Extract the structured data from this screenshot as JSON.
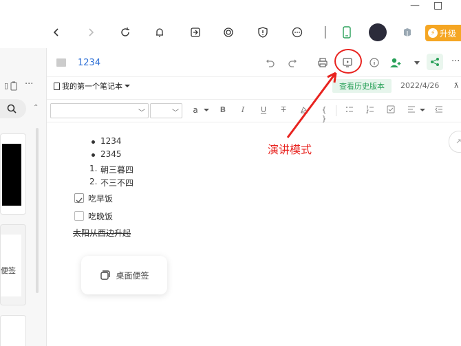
{
  "window": {
    "minimize": "—",
    "maximize": "□"
  },
  "toolbar": {
    "upgrade_label": "升级"
  },
  "note": {
    "title": "1234",
    "notebook": "我的第一个笔记本",
    "history_label": "查看历史版本",
    "date": "2022/4/26"
  },
  "format": {
    "font_color_label": "a"
  },
  "content": {
    "bullets": [
      "1234",
      "2345"
    ],
    "numbered": [
      {
        "num": "1.",
        "text": "朝三暮四"
      },
      {
        "num": "2.",
        "text": "不三不四"
      }
    ],
    "tasks": [
      {
        "text": "吃早饭",
        "checked": true
      },
      {
        "text": "吃晚饭",
        "checked": false
      }
    ],
    "struck": "太阳从西边升起",
    "sticky_label": "桌面便签"
  },
  "sidebar": {
    "card_text": "便签"
  },
  "annotation": {
    "label": "演讲模式",
    "color": "#e8231f"
  },
  "colors": {
    "accent": "#2d6fd6",
    "green": "#28a058",
    "upgrade": "#f5a623"
  }
}
